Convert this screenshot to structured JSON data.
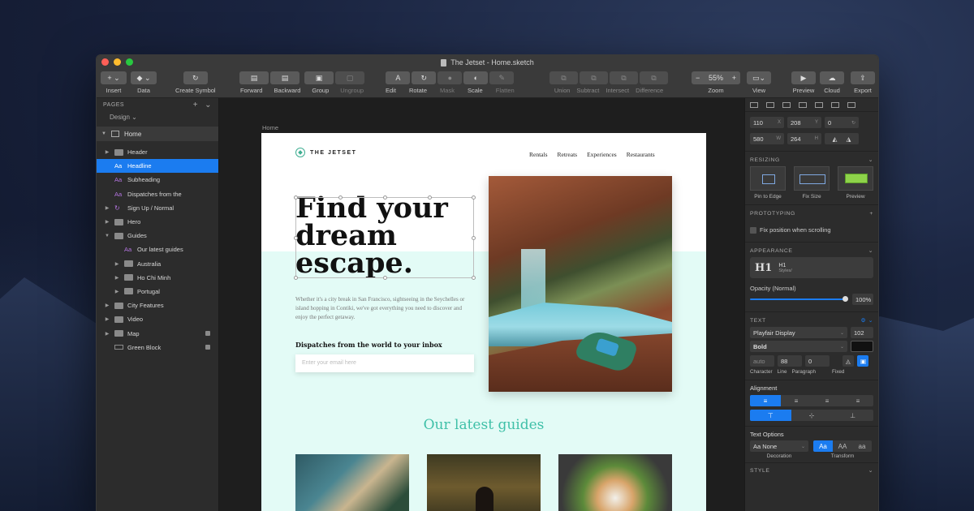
{
  "window": {
    "title": "The Jetset - Home.sketch"
  },
  "toolbar": {
    "insert": "Insert",
    "data": "Data",
    "create_symbol": "Create Symbol",
    "forward": "Forward",
    "backward": "Backward",
    "group": "Group",
    "ungroup": "Ungroup",
    "edit": "Edit",
    "rotate": "Rotate",
    "mask": "Mask",
    "scale": "Scale",
    "flatten": "Flatten",
    "union": "Union",
    "subtract": "Subtract",
    "intersect": "Intersect",
    "difference": "Difference",
    "zoom_value": "55%",
    "zoom": "Zoom",
    "view": "View",
    "preview": "Preview",
    "cloud": "Cloud",
    "export": "Export"
  },
  "sidebar": {
    "pages_header": "PAGES",
    "design": "Design",
    "page": "Home",
    "layers": [
      {
        "label": "Header",
        "type": "folder",
        "indent": 1,
        "arrow": "▶"
      },
      {
        "label": "Headline",
        "type": "text",
        "indent": 1,
        "selected": true
      },
      {
        "label": "Subheading",
        "type": "text",
        "indent": 1
      },
      {
        "label": "Dispatches from the",
        "type": "text",
        "indent": 1
      },
      {
        "label": "Sign Up / Normal",
        "type": "symbol",
        "indent": 1,
        "arrow": "▶"
      },
      {
        "label": "Hero",
        "type": "folder",
        "indent": 1,
        "arrow": "▶"
      },
      {
        "label": "Guides",
        "type": "folder",
        "indent": 1,
        "arrow": "▼"
      },
      {
        "label": "Our latest guides",
        "type": "text",
        "indent": 2
      },
      {
        "label": "Australia",
        "type": "folder",
        "indent": 2,
        "arrow": "▶"
      },
      {
        "label": "Ho Chi Minh",
        "type": "folder",
        "indent": 2,
        "arrow": "▶"
      },
      {
        "label": "Portugal",
        "type": "folder",
        "indent": 2,
        "arrow": "▶"
      },
      {
        "label": "City Features",
        "type": "folder",
        "indent": 1,
        "arrow": "▶"
      },
      {
        "label": "Video",
        "type": "folder",
        "indent": 1,
        "arrow": "▶"
      },
      {
        "label": "Map",
        "type": "folder",
        "indent": 1,
        "arrow": "▶",
        "locked": true
      },
      {
        "label": "Green Block",
        "type": "rect",
        "indent": 1,
        "locked": true
      }
    ]
  },
  "canvas": {
    "artboard_label": "Home",
    "logo": "THE JETSET",
    "nav": [
      "Rentals",
      "Retreats",
      "Experiences",
      "Restaurants"
    ],
    "hero_title": "Find your dream escape.",
    "hero_sub": "Whether it's a city break in San Francisco, sightseeing in the Seychelles or island hopping in Contiki, we've got everything you need to discover and enjoy the perfect getaway.",
    "dispatch_title": "Dispatches from the world to your inbox",
    "email_placeholder": "Enter your email here",
    "guides_title": "Our latest guides"
  },
  "inspector": {
    "x": "110",
    "x_suf": "X",
    "y": "208",
    "y_suf": "Y",
    "r": "0",
    "w": "580",
    "w_suf": "W",
    "h": "264",
    "h_suf": "H",
    "resizing": "RESIZING",
    "pin_to_edge": "Pin to Edge",
    "fix_size": "Fix Size",
    "preview": "Preview",
    "prototyping": "PROTOTYPING",
    "fix_scroll": "Fix position when scrolling",
    "appearance": "APPEARANCE",
    "style_name": "H1",
    "style_path": "Styles/",
    "opacity_label": "Opacity (Normal)",
    "opacity": "100%",
    "text": "TEXT",
    "font": "Playfair Display",
    "font_size": "102",
    "weight": "Bold",
    "char": "auto",
    "line": "88",
    "para": "0",
    "char_label": "Character",
    "line_label": "Line",
    "para_label": "Paragraph",
    "fixed_label": "Fixed",
    "alignment": "Alignment",
    "text_options": "Text Options",
    "decoration": "Aa None",
    "decoration_label": "Decoration",
    "transform_label": "Transform",
    "transform": [
      "Aa",
      "AA",
      "aa"
    ],
    "style": "STYLE"
  },
  "colors": {
    "accent": "#1b7cf0",
    "mint": "#e3fbf6",
    "teal": "#3fc0a8"
  }
}
